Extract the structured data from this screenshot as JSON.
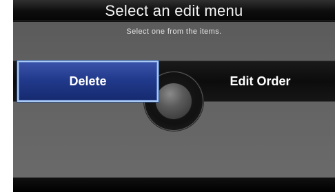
{
  "screen": {
    "title": "Select an edit menu",
    "subtitle": "Select one from the items."
  },
  "menu": {
    "items": [
      {
        "label": "Delete",
        "selected": true
      },
      {
        "label": "Edit Order",
        "selected": false
      }
    ]
  },
  "colors": {
    "selected_fill": "#223a8c",
    "selected_border": "#a9c9f2",
    "background": "#636363",
    "bar": "#0d0d0d"
  }
}
